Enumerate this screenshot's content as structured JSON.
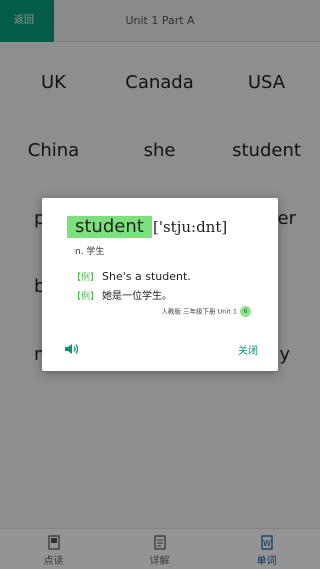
{
  "header": {
    "back_label": "返回",
    "title": "Unit 1  Part A"
  },
  "grid": {
    "words": [
      "UK",
      "Canada",
      "USA",
      "China",
      "she",
      "student",
      "p",
      "",
      "her",
      "b",
      "",
      "",
      "m",
      "",
      "ay"
    ]
  },
  "tabs": [
    {
      "label": "点读",
      "icon": "book-icon"
    },
    {
      "label": "详解",
      "icon": "document-icon"
    },
    {
      "label": "单词",
      "icon": "word-doc-icon"
    }
  ],
  "dialog": {
    "word": "student",
    "phonetic": "['stju:dnt]",
    "meaning": "n. 学生",
    "example_tag": "【例】",
    "example_en": "She's a student.",
    "example_cn": "她是一位学生。",
    "source": "人教版 三年级下册 Unit 1",
    "source_badge": "6",
    "close_label": "关闭"
  },
  "colors": {
    "accent": "#07a07e",
    "highlight": "#7de07d",
    "tab_active": "#0d5aa7"
  }
}
